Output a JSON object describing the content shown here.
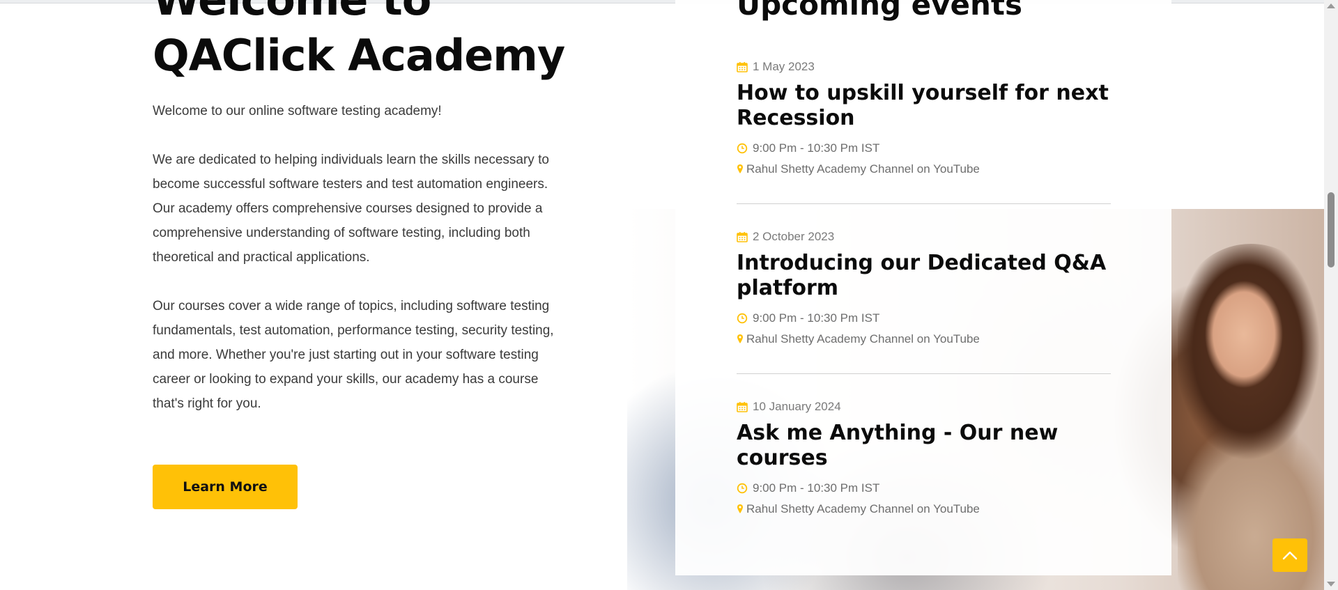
{
  "hero": {
    "title_line1": "Welcome to",
    "title_line2": "QAClick Academy",
    "intro": "Welcome to our online software testing academy!",
    "paragraph1": "We are dedicated to helping individuals learn the skills necessary to become successful software testers and test automation engineers. Our academy offers comprehensive courses designed to provide a comprehensive understanding of software testing, including both theoretical and practical applications.",
    "paragraph2": "Our courses cover a wide range of topics, including software testing fundamentals, test automation, performance testing, security testing, and more. Whether you're just starting out in your software testing career or looking to expand your skills, our academy has a course that's right for you.",
    "button_label": "Learn More"
  },
  "events": {
    "heading": "Upcoming events",
    "accent_color": "#ffc107",
    "items": [
      {
        "date": "1 May 2023",
        "title": "How to upskill yourself for next Recession",
        "time": "9:00 Pm - 10:30 Pm IST",
        "location": "Rahul Shetty Academy Channel on YouTube"
      },
      {
        "date": "2 October 2023",
        "title": "Introducing our Dedicated Q&A platform",
        "time": "9:00 Pm - 10:30 Pm IST",
        "location": "Rahul Shetty Academy Channel on YouTube"
      },
      {
        "date": "10 January 2024",
        "title": "Ask me Anything - Our new courses",
        "time": "9:00 Pm - 10:30 Pm IST",
        "location": "Rahul Shetty Academy Channel on YouTube"
      }
    ]
  },
  "icons": {
    "date": "calendar-icon",
    "time": "clock-icon",
    "location": "map-marker-icon",
    "back_to_top": "chevron-up-icon"
  }
}
